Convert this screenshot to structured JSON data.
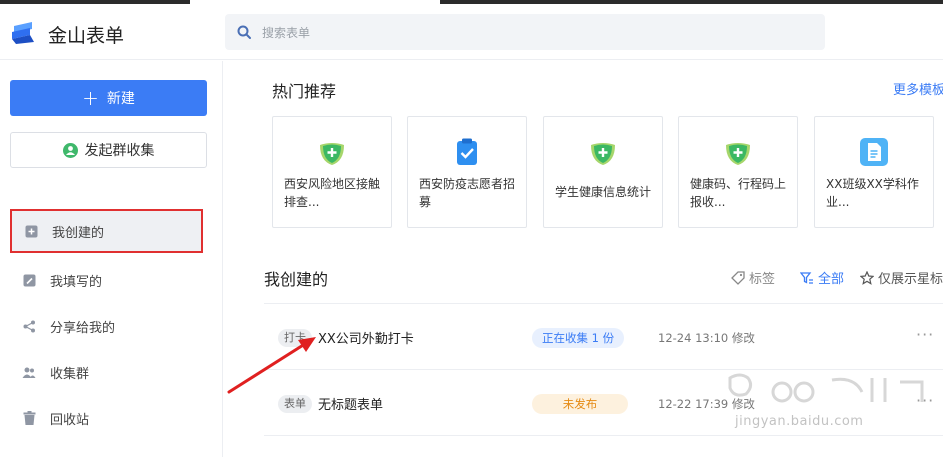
{
  "app": {
    "title": "金山表单"
  },
  "search": {
    "placeholder": "搜索表单"
  },
  "sidebar": {
    "new_button": "新建",
    "group_button": "发起群收集",
    "items": [
      {
        "label": "我创建的",
        "icon": "form-plus-icon",
        "active": true
      },
      {
        "label": "我填写的",
        "icon": "edit-icon"
      },
      {
        "label": "分享给我的",
        "icon": "share-icon"
      },
      {
        "label": "收集群",
        "icon": "group-icon"
      },
      {
        "label": "回收站",
        "icon": "trash-icon"
      }
    ]
  },
  "hot": {
    "title": "热门推荐",
    "more": "更多模板",
    "cards": [
      {
        "label": "西安风险地区接触排查...",
        "icon": "green-shield-plus-icon"
      },
      {
        "label": "西安防疫志愿者招募",
        "icon": "blue-clipboard-check-icon"
      },
      {
        "label": "学生健康信息统计",
        "icon": "green-shield-plus-icon"
      },
      {
        "label": "健康码、行程码上报收...",
        "icon": "green-shield-plus-icon"
      },
      {
        "label": "XX班级XX学科作业...",
        "icon": "blue-document-icon"
      }
    ]
  },
  "mine": {
    "title": "我创建的",
    "filter_tag": "标签",
    "filter_all": "全部",
    "filter_star": "仅展示星标",
    "rows": [
      {
        "tag": "打卡",
        "name": "XX公司外勤打卡",
        "status": "正在收集 1 份",
        "status_type": "collecting",
        "time": "12-24 13:10 修改",
        "more": "···"
      },
      {
        "tag": "表单",
        "name": "无标题表单",
        "status": "未发布",
        "status_type": "draft",
        "time": "12-22 17:39 修改",
        "more": "···"
      }
    ]
  },
  "watermark": {
    "text": "jingyan.baidu.com"
  },
  "colors": {
    "accent": "#3b7cf5",
    "highlight_border": "#e03030",
    "arrow": "#e02020",
    "draft": "#e58a13"
  }
}
